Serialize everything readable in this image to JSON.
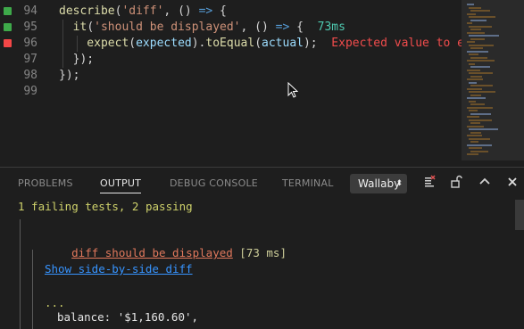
{
  "editor": {
    "lines": [
      {
        "num": "94",
        "marker": "#3ea94a",
        "tokens": [
          {
            "t": "describe",
            "c": "#dcdcaa"
          },
          {
            "t": "(",
            "c": "#d4d4d4"
          },
          {
            "t": "'diff'",
            "c": "#ce9178"
          },
          {
            "t": ", () ",
            "c": "#d4d4d4"
          },
          {
            "t": "=>",
            "c": "#569cd6"
          },
          {
            "t": " {",
            "c": "#d4d4d4"
          }
        ]
      },
      {
        "num": "95",
        "marker": "#3ea94a",
        "tokens": [
          {
            "t": "  it",
            "c": "#dcdcaa"
          },
          {
            "t": "(",
            "c": "#d4d4d4"
          },
          {
            "t": "'should be displayed'",
            "c": "#ce9178"
          },
          {
            "t": ", () ",
            "c": "#d4d4d4"
          },
          {
            "t": "=>",
            "c": "#569cd6"
          },
          {
            "t": " {  ",
            "c": "#d4d4d4"
          },
          {
            "t": "73ms",
            "c": "#4ec9b0"
          }
        ]
      },
      {
        "num": "96",
        "marker": "#f44747",
        "tokens": [
          {
            "t": "    expect",
            "c": "#dcdcaa"
          },
          {
            "t": "(",
            "c": "#d4d4d4"
          },
          {
            "t": "expected",
            "c": "#9cdcfe"
          },
          {
            "t": ").",
            "c": "#d4d4d4"
          },
          {
            "t": "toEqual",
            "c": "#dcdcaa"
          },
          {
            "t": "(",
            "c": "#d4d4d4"
          },
          {
            "t": "actual",
            "c": "#9cdcfe"
          },
          {
            "t": ");  ",
            "c": "#d4d4d4"
          },
          {
            "t": "Expected value to equal:",
            "c": "#f14c4c"
          }
        ]
      },
      {
        "num": "97",
        "marker": "",
        "tokens": [
          {
            "t": "  });",
            "c": "#d4d4d4"
          }
        ]
      },
      {
        "num": "98",
        "marker": "",
        "tokens": [
          {
            "t": "});",
            "c": "#d4d4d4"
          }
        ]
      },
      {
        "num": "99",
        "marker": "",
        "tokens": []
      }
    ]
  },
  "panel": {
    "tabs": {
      "problems": "PROBLEMS",
      "output": "OUTPUT",
      "debug_console": "DEBUG CONSOLE",
      "terminal": "TERMINAL"
    },
    "channel_select": "Wallaby",
    "icons": [
      "clear-output-icon",
      "lock-icon",
      "chevron-up-icon",
      "close-icon"
    ]
  },
  "output": {
    "summary": "1 failing tests, 2 passing",
    "test_name": "diff should be displayed",
    "test_time": " [73 ms]",
    "diff_link": "Show side-by-side diff",
    "ellipsis": "...",
    "balance_line": "balance: '$1,160.60',"
  }
}
